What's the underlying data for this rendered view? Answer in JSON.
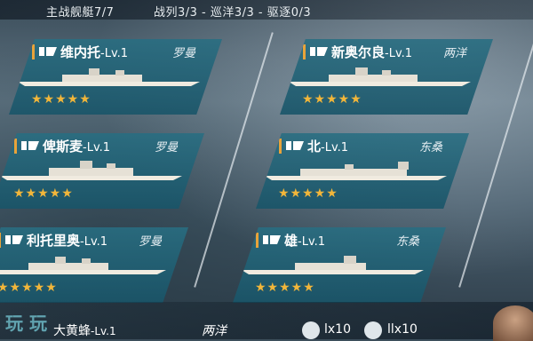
{
  "header": {
    "main_ships": "主战舰艇7/7",
    "counts": "战列3/3 - 巡洋3/3 - 驱逐0/3"
  },
  "ships": [
    {
      "name": "维内托",
      "level": "-Lv.1",
      "faction": "罗曼",
      "stars": "★★★★★"
    },
    {
      "name": "新奥尔良",
      "level": "-Lv.1",
      "faction": "两洋",
      "stars": "★★★★★"
    },
    {
      "name": "俾斯麦",
      "level": "-Lv.1",
      "faction": "罗曼",
      "stars": "★★★★★"
    },
    {
      "name": "北",
      "level": "-Lv.1",
      "faction": "东桑",
      "stars": "★★★★★"
    },
    {
      "name": "利托里奥",
      "level": "-Lv.1",
      "faction": "罗曼",
      "stars": "★★★★★"
    },
    {
      "name": "雄",
      "level": "-Lv.1",
      "faction": "东桑",
      "stars": "★★★★★"
    }
  ],
  "bottom": {
    "ship_name": "大黄蜂",
    "ship_level": "-Lv.1",
    "ship_faction": "两洋",
    "count1": "lx10",
    "count2": "llx10",
    "watermark": "玩 玩"
  },
  "colors": {
    "card": "#2a7488",
    "accent": "#e8a33a",
    "star": "#f2b63a"
  },
  "icons": [
    "ship-type-icon",
    "star-icon",
    "ammo-icon"
  ]
}
